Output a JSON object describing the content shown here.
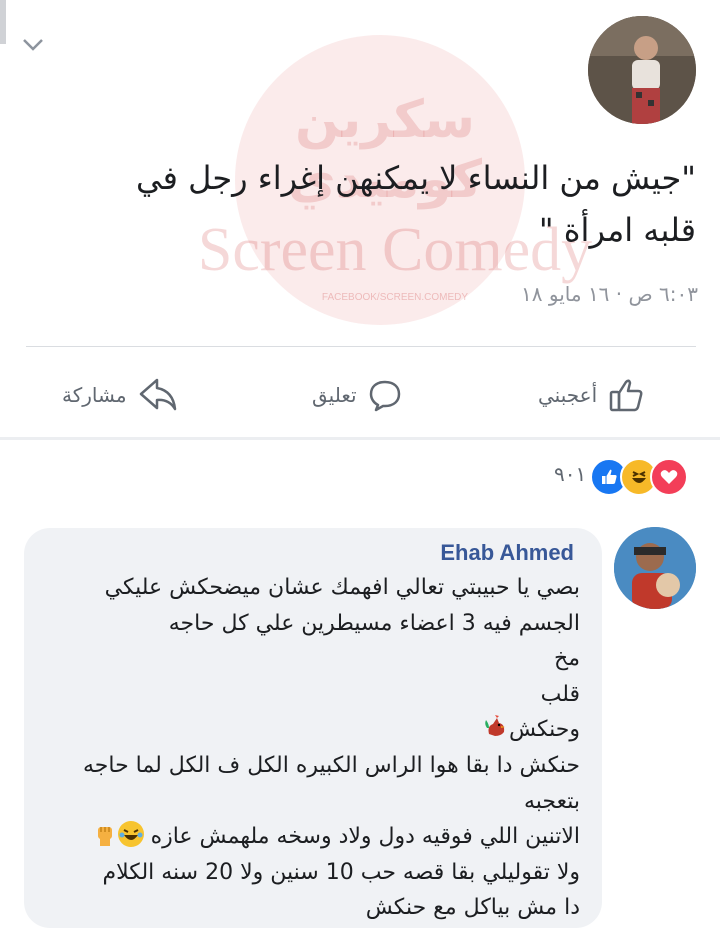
{
  "watermark": {
    "arabic": "سكرين كوميدي",
    "english": "Screen Comedy",
    "url": "FACEBOOK/SCREEN.COMEDY"
  },
  "post": {
    "text_line_1": "\"جيش من النساء لا يمكنهن إغراء رجل في",
    "text_line_2": "قلبه امرأة \"",
    "meta": "٦:٠٣ ص · ١٦ مايو ١٨"
  },
  "actions": {
    "like": "أعجبني",
    "comment": "تعليق",
    "share": "مشاركة"
  },
  "reactions": {
    "count": "٩٠١",
    "types": [
      "like-icon",
      "haha-icon",
      "love-icon"
    ],
    "colors": {
      "like": "#1877f2",
      "haha": "#f7b928",
      "love": "#f33e58"
    }
  },
  "comment": {
    "author": "Ehab Ahmed",
    "lines": [
      "بصي يا حبيبتي تعالي افهمك عشان ميضحكش عليكي",
      "الجسم فيه 3 اعضاء مسيطرين علي كل حاجه",
      "مخ",
      "قلب",
      "وحنكش",
      "حنكش دا بقا هوا الراس الكبيره الكل ف الكل لما حاجه",
      "بتعجبه",
      "الاتنين اللي فوقيه دول ولاد وسخه ملهمش عازه",
      "ولا تقوليلي بقا قصه حب 10 سنين ولا 20 سنه الكلام",
      "دا مش بياكل مع حنكش"
    ],
    "line_5_emoji": "rooster-icon",
    "line_8_emojis": [
      "laughing-tears-icon",
      "raised-fist-icon"
    ]
  },
  "colors": {
    "author_link": "#385898",
    "secondary_text": "#606770",
    "bubble": "#f0f2f5"
  }
}
